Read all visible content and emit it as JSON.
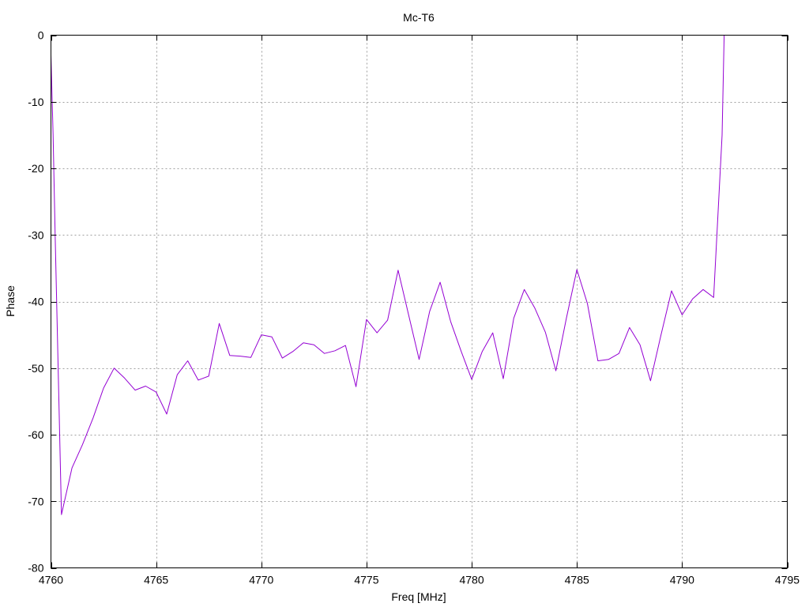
{
  "chart_data": {
    "type": "line",
    "title": "Mc-T6",
    "xlabel": "Freq [MHz]",
    "ylabel": "Phase",
    "xlim": [
      4760,
      4795
    ],
    "ylim": [
      -80,
      0
    ],
    "x_ticks": [
      4760,
      4765,
      4770,
      4775,
      4780,
      4785,
      4790,
      4795
    ],
    "y_ticks": [
      0,
      -10,
      -20,
      -30,
      -40,
      -50,
      -60,
      -70,
      -80
    ],
    "grid": true,
    "colors": {
      "series": "#9400d3",
      "grid": "#a0a0a0",
      "axis": "#000000"
    },
    "series": [
      {
        "x": [
          4760.0,
          4760.1,
          4760.2,
          4760.5,
          4761.0,
          4761.5,
          4762.0,
          4762.5,
          4763.0,
          4763.5,
          4764.0,
          4764.5,
          4765.0,
          4765.5,
          4766.0,
          4766.5,
          4767.0,
          4767.5,
          4768.0,
          4768.5,
          4769.0,
          4769.5,
          4770.0,
          4770.5,
          4771.0,
          4771.5,
          4772.0,
          4772.5,
          4773.0,
          4773.5,
          4774.0,
          4774.5,
          4775.0,
          4775.5,
          4776.0,
          4776.5,
          4777.0,
          4777.5,
          4778.0,
          4778.5,
          4779.0,
          4779.5,
          4780.0,
          4780.5,
          4781.0,
          4781.5,
          4782.0,
          4782.5,
          4783.0,
          4783.5,
          4784.0,
          4784.5,
          4785.0,
          4785.5,
          4786.0,
          4786.5,
          4787.0,
          4787.5,
          4788.0,
          4788.5,
          4789.0,
          4789.5,
          4790.0,
          4790.5,
          4791.0,
          4791.5,
          4791.9,
          4792.0
        ],
        "values": [
          -3,
          -15,
          -30,
          -72,
          -65,
          -61.5,
          -57.5,
          -53,
          -50,
          -51.5,
          -53.3,
          -52.7,
          -53.6,
          -56.9,
          -51,
          -48.9,
          -51.8,
          -51.2,
          -43.3,
          -48.1,
          -48.2,
          -48.4,
          -45,
          -45.3,
          -48.5,
          -47.5,
          -46.2,
          -46.5,
          -47.8,
          -47.4,
          -46.6,
          -52.8,
          -42.7,
          -44.7,
          -42.8,
          -35.3,
          -42,
          -48.7,
          -41.5,
          -37.1,
          -43,
          -47.5,
          -51.7,
          -47.5,
          -44.7,
          -51.6,
          -42.5,
          -38.2,
          -41,
          -44.6,
          -50.4,
          -42.5,
          -35.2,
          -40.3,
          -48.9,
          -48.7,
          -47.8,
          -43.9,
          -46.5,
          -51.9,
          -45,
          -38.4,
          -42,
          -39.6,
          -38.2,
          -39.4,
          -15,
          0
        ]
      }
    ]
  }
}
